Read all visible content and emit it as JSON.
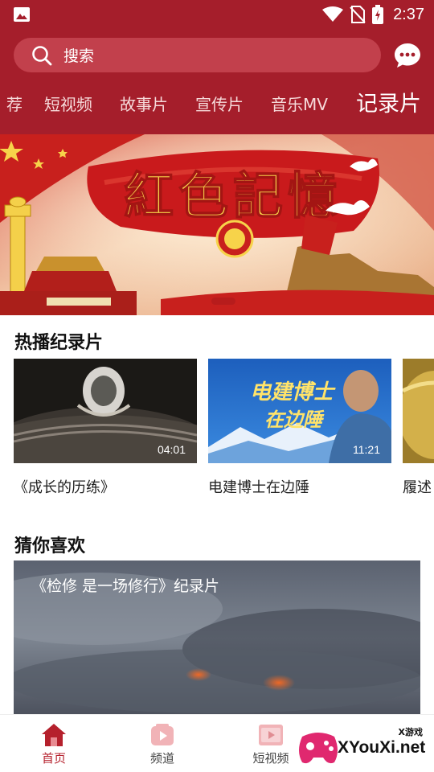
{
  "status_bar": {
    "time": "2:37",
    "icons": [
      "image-icon",
      "wifi-icon",
      "no-sim-icon",
      "battery-icon"
    ]
  },
  "search": {
    "placeholder": "搜索"
  },
  "tabs": [
    {
      "label": "荐",
      "active": false
    },
    {
      "label": "短视频",
      "active": false
    },
    {
      "label": "故事片",
      "active": false
    },
    {
      "label": "宣传片",
      "active": false
    },
    {
      "label": "音乐MV",
      "active": false
    },
    {
      "label": "记录片",
      "active": true
    }
  ],
  "banner": {
    "text": "紅色記憶",
    "slide_count": 1,
    "active_slide": 1
  },
  "hot_section": {
    "title": "热播纪录片",
    "items": [
      {
        "title": "《成长的历练》",
        "duration": "04:01"
      },
      {
        "title": "电建博士在边陲",
        "duration": "11:21",
        "thumb_text": "电建博士在边陲"
      },
      {
        "title": "履述",
        "duration": ""
      }
    ]
  },
  "guess_section": {
    "title": "猜你喜欢",
    "items": [
      {
        "title": "《检修 是一场修行》纪录片"
      }
    ]
  },
  "bottom_nav": [
    {
      "label": "首页",
      "icon": "home-icon",
      "active": true
    },
    {
      "label": "频道",
      "icon": "channel-play-icon",
      "active": false
    },
    {
      "label": "短视频",
      "icon": "short-video-icon",
      "active": false
    }
  ],
  "watermark": {
    "small": "X游戏",
    "text": "XYouXi.net"
  },
  "colors": {
    "header": "#a51e2b",
    "search_bg": "#c2404c",
    "active_nav": "#b5202c"
  }
}
